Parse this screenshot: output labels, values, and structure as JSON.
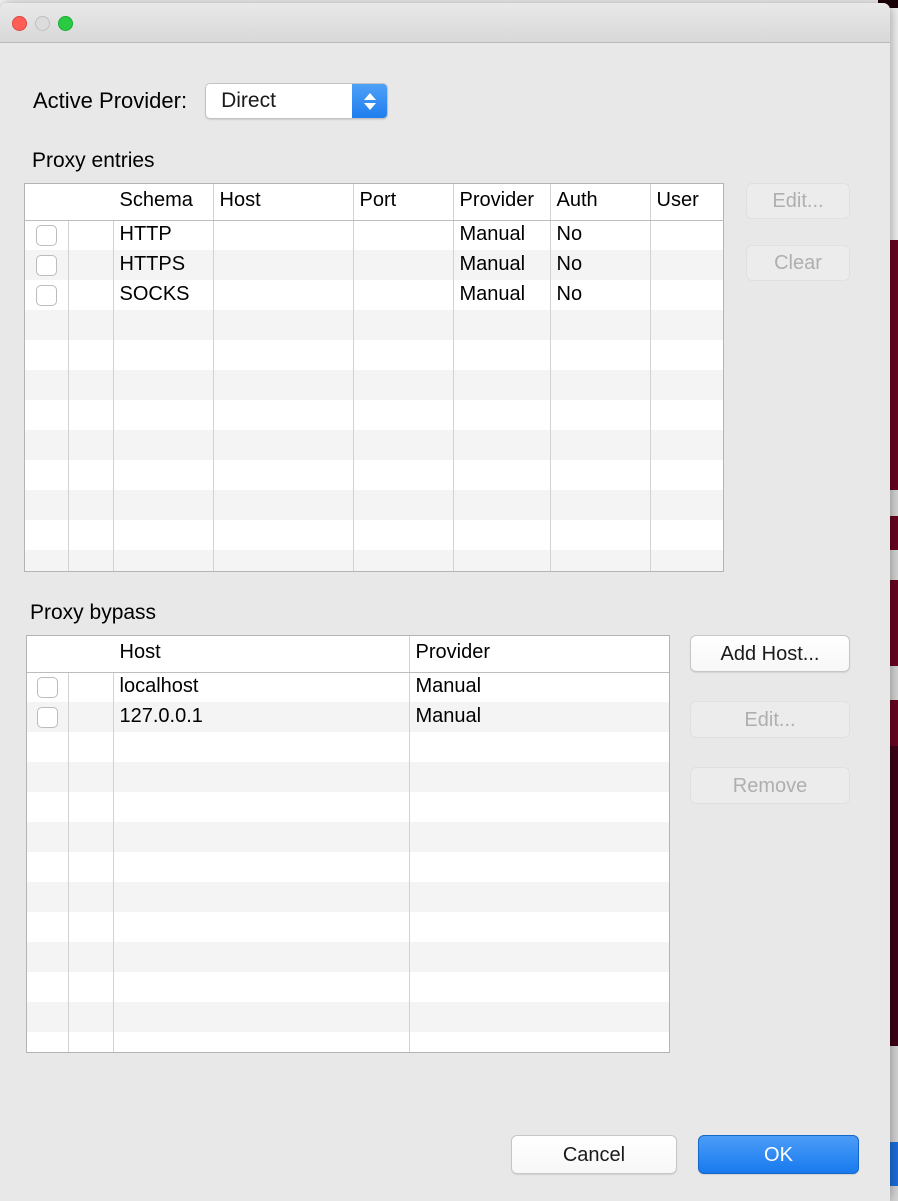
{
  "window": {
    "traffic_lights": [
      "close",
      "minimize",
      "zoom"
    ],
    "accent_blue": "#1f7ded",
    "backdrop_color": "#6b0320"
  },
  "provider": {
    "label": "Active Provider:",
    "selected": "Direct",
    "options": [
      "Direct"
    ]
  },
  "entries": {
    "title": "Proxy entries",
    "columns": [
      "",
      "",
      "Schema",
      "Host",
      "Port",
      "Provider",
      "Auth",
      "User"
    ],
    "rows": [
      {
        "checked": false,
        "schema": "HTTP",
        "host": "",
        "port": "",
        "provider": "Manual",
        "auth": "No",
        "user": ""
      },
      {
        "checked": false,
        "schema": "HTTPS",
        "host": "",
        "port": "",
        "provider": "Manual",
        "auth": "No",
        "user": ""
      },
      {
        "checked": false,
        "schema": "SOCKS",
        "host": "",
        "port": "",
        "provider": "Manual",
        "auth": "No",
        "user": ""
      }
    ],
    "empty_row_count": 11,
    "buttons": [
      {
        "label": "Edit...",
        "enabled": false
      },
      {
        "label": "Clear",
        "enabled": false
      }
    ]
  },
  "bypass": {
    "title": "Proxy bypass",
    "columns": [
      "",
      "",
      "Host",
      "Provider"
    ],
    "rows": [
      {
        "checked": false,
        "host": "localhost",
        "provider": "Manual"
      },
      {
        "checked": false,
        "host": "127.0.0.1",
        "provider": "Manual"
      }
    ],
    "empty_row_count": 11,
    "buttons": [
      {
        "label": "Add Host...",
        "enabled": true
      },
      {
        "label": "Edit...",
        "enabled": false
      },
      {
        "label": "Remove",
        "enabled": false
      }
    ]
  },
  "footer": {
    "cancel_label": "Cancel",
    "ok_label": "OK"
  }
}
